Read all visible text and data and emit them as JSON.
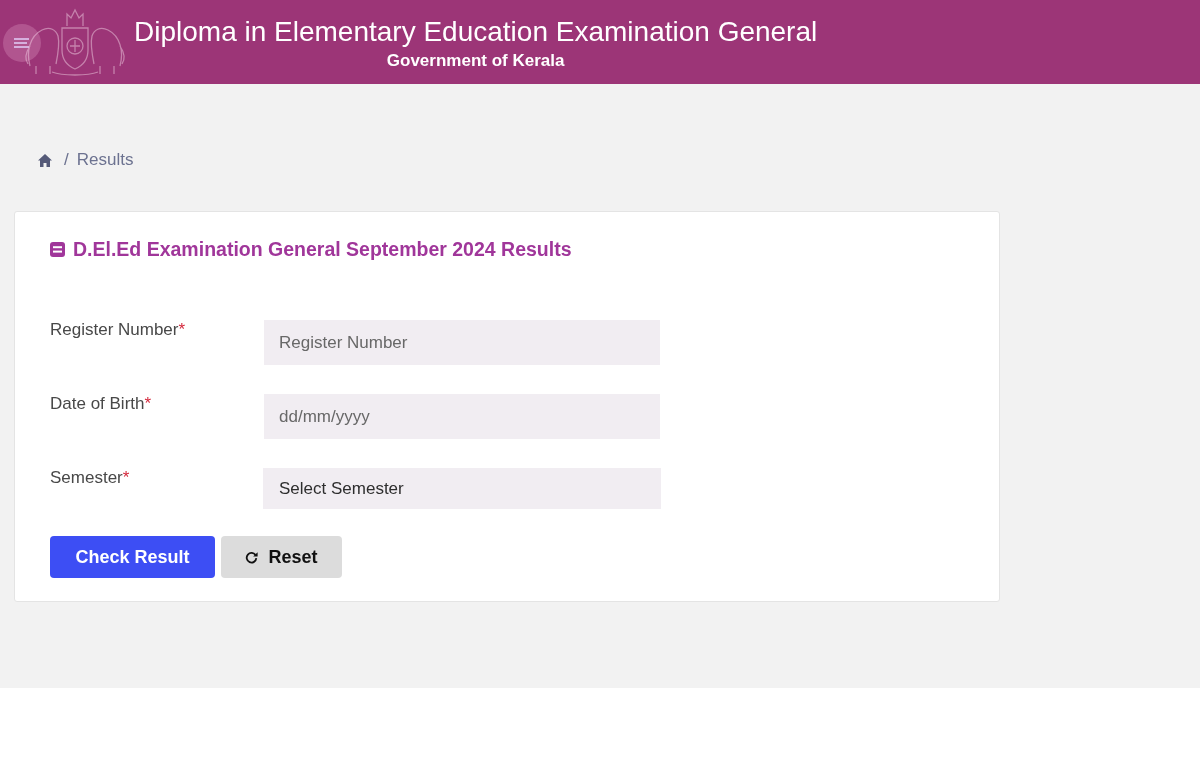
{
  "header": {
    "title": "Diploma in Elementary Education Examination General",
    "subtitle": "Government of Kerala"
  },
  "breadcrumb": {
    "separator": "/",
    "items": [
      "Results"
    ]
  },
  "form": {
    "title": "D.El.Ed Examination General September 2024 Results",
    "fields": [
      {
        "kind": "text",
        "label": "Register Number",
        "required_mark": "*",
        "placeholder": "Register Number"
      },
      {
        "kind": "date",
        "label": "Date of Birth",
        "required_mark": "*",
        "placeholder": "dd/mm/yyyy"
      },
      {
        "kind": "select",
        "label": "Semester",
        "required_mark": "*",
        "value": "Select Semester"
      }
    ],
    "buttons": [
      {
        "kind": "primary",
        "label": "Check Result"
      },
      {
        "kind": "reset",
        "label": "Reset"
      }
    ]
  }
}
